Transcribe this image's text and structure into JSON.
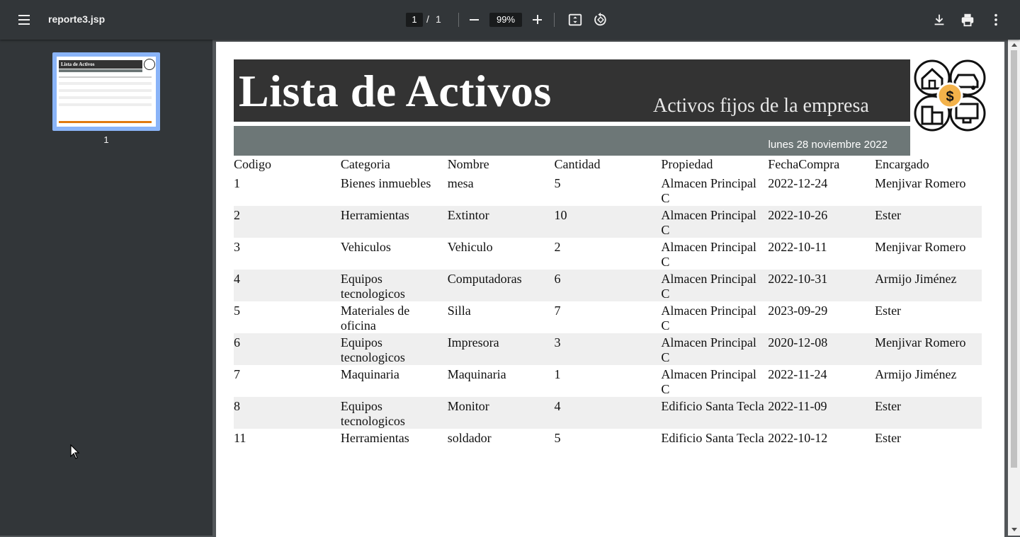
{
  "toolbar": {
    "title": "reporte3.jsp",
    "page_current": "1",
    "page_separator": "/",
    "page_total": "1",
    "zoom": "99%"
  },
  "sidebar": {
    "thumbnail_number": "1"
  },
  "report": {
    "title": "Lista de Activos",
    "subtitle": "Activos fijos de la empresa",
    "date": "lunes 28 noviembre 2022",
    "headers": [
      "Codigo",
      "Categoria",
      "Nombre",
      "Cantidad",
      "Propiedad",
      "FechaCompra",
      "Encargado"
    ],
    "rows": [
      [
        "1",
        "Bienes inmuebles",
        "mesa",
        "5",
        "Almacen Principal C",
        "2022-12-24",
        "Menjivar Romero"
      ],
      [
        "2",
        "Herramientas",
        "Extintor",
        "10",
        "Almacen Principal C",
        "2022-10-26",
        "Ester"
      ],
      [
        "3",
        "Vehiculos",
        "Vehiculo",
        "2",
        "Almacen Principal C",
        "2022-10-11",
        "Menjivar Romero"
      ],
      [
        "4",
        "Equipos tecnologicos",
        "Computadoras",
        "6",
        "Almacen Principal C",
        "2022-10-31",
        "Armijo Jiménez"
      ],
      [
        "5",
        "Materiales de oficina",
        "Silla",
        "7",
        "Almacen Principal C",
        "2023-09-29",
        "Ester"
      ],
      [
        "6",
        "Equipos tecnologicos",
        "Impresora",
        "3",
        "Almacen Principal C",
        "2020-12-08",
        "Menjivar Romero"
      ],
      [
        "7",
        "Maquinaria",
        "Maquinaria",
        "1",
        "Almacen Principal C",
        "2022-11-24",
        "Armijo Jiménez"
      ],
      [
        "8",
        "Equipos tecnologicos",
        "Monitor",
        "4",
        "Edificio Santa Tecla",
        "2022-11-09",
        "Ester"
      ],
      [
        "11",
        "Herramientas",
        "soldador",
        "5",
        "Edificio Santa Tecla",
        "2022-10-12",
        "Ester"
      ]
    ]
  },
  "icons": {
    "menu": "menu-icon",
    "zoom_out": "minus-icon",
    "zoom_in": "plus-icon",
    "fit": "fit-page-icon",
    "rotate": "rotate-icon",
    "download": "download-icon",
    "print": "print-icon",
    "more": "more-vert-icon"
  },
  "colors": {
    "toolbar": "#323639",
    "viewer_bg": "#525659",
    "banner": "#333333",
    "datebar": "#6d7777",
    "alt_row": "#efefef",
    "thumb_selected": "#8ab4f8",
    "logo_accent": "#f3b24a"
  }
}
